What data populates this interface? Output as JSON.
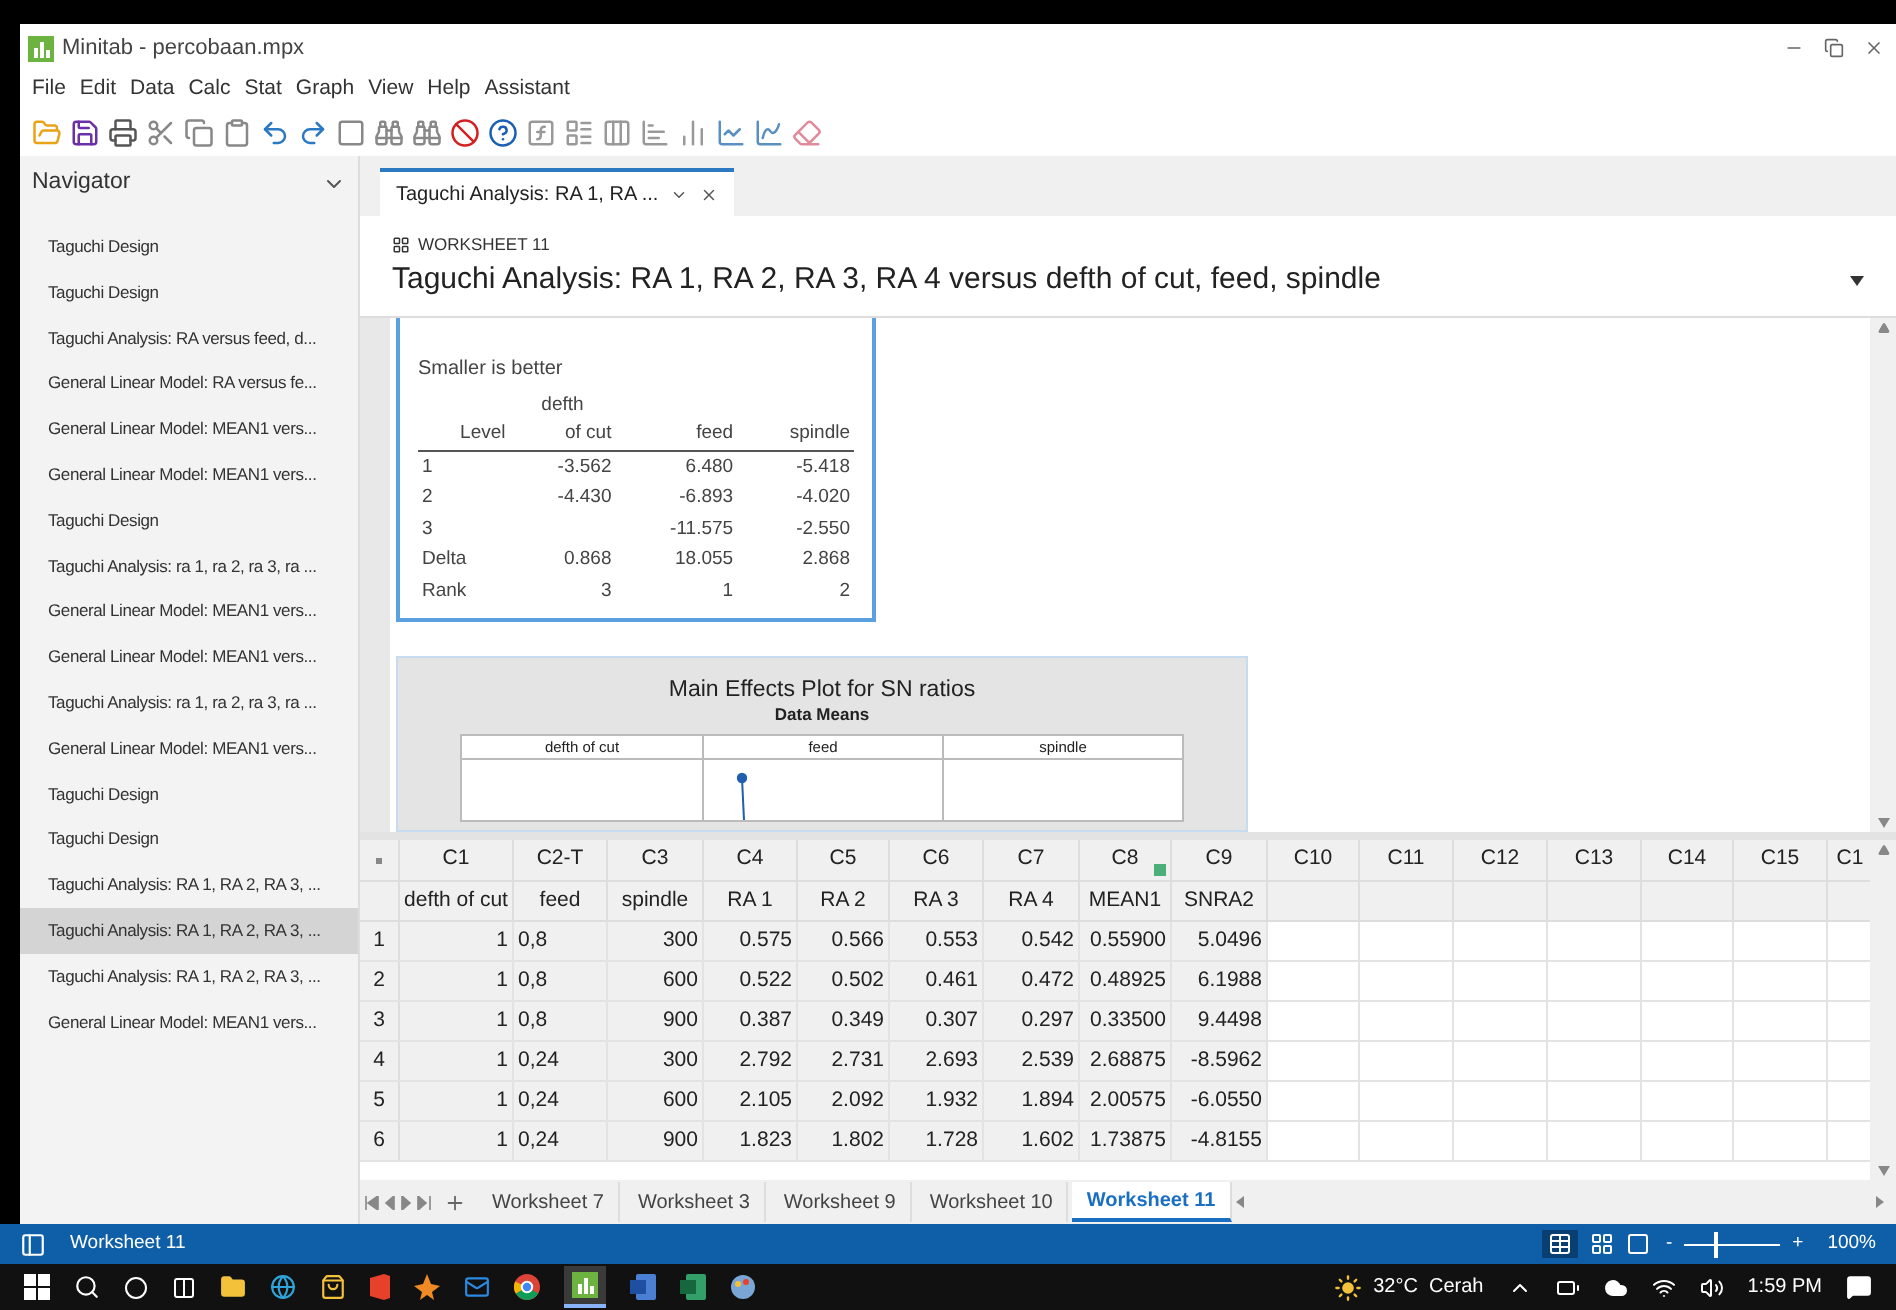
{
  "window": {
    "title": "Minitab - percobaan.mpx"
  },
  "menu": [
    "File",
    "Edit",
    "Data",
    "Calc",
    "Stat",
    "Graph",
    "View",
    "Help",
    "Assistant"
  ],
  "navigator": {
    "title": "Navigator",
    "items": [
      {
        "label": "Taguchi Design",
        "selected": false
      },
      {
        "label": "Taguchi Design",
        "selected": false
      },
      {
        "label": "Taguchi Analysis: RA versus feed, d...",
        "selected": false
      },
      {
        "label": "General Linear Model: RA versus fe...",
        "selected": false
      },
      {
        "label": "General Linear Model: MEAN1 vers...",
        "selected": false
      },
      {
        "label": "General Linear Model: MEAN1 vers...",
        "selected": false
      },
      {
        "label": "Taguchi Design",
        "selected": false
      },
      {
        "label": "Taguchi Analysis: ra 1, ra 2, ra 3, ra ...",
        "selected": false
      },
      {
        "label": "General Linear Model: MEAN1 vers...",
        "selected": false
      },
      {
        "label": "General Linear Model: MEAN1 vers...",
        "selected": false
      },
      {
        "label": "Taguchi Analysis: ra 1, ra 2, ra 3, ra ...",
        "selected": false
      },
      {
        "label": "General Linear Model: MEAN1 vers...",
        "selected": false
      },
      {
        "label": "Taguchi Design",
        "selected": false
      },
      {
        "label": "Taguchi Design",
        "selected": false
      },
      {
        "label": "Taguchi Analysis: RA 1, RA 2, RA 3, ...",
        "selected": false
      },
      {
        "label": "Taguchi Analysis: RA 1, RA 2, RA 3, ...",
        "selected": true
      },
      {
        "label": "Taguchi Analysis: RA 1, RA 2, RA 3, ...",
        "selected": false
      },
      {
        "label": "General Linear Model: MEAN1 vers...",
        "selected": false
      }
    ]
  },
  "output_tabs": [
    {
      "label": "Taguchi Analysis: RA 1, RA ...",
      "selected": true
    }
  ],
  "output": {
    "worksheet_label": "WORKSHEET 11",
    "title": "Taguchi Analysis: RA 1, RA 2, RA 3, RA 4 versus defth of cut, feed, spindle",
    "response_table": {
      "note": "Smaller is better",
      "columns": [
        {
          "label": "Level"
        },
        {
          "top": "defth",
          "label": "of cut"
        },
        {
          "label": "feed"
        },
        {
          "label": "spindle"
        }
      ],
      "rows": [
        [
          "1",
          "-3.562",
          "6.480",
          "-5.418"
        ],
        [
          "2",
          "-4.430",
          "-6.893",
          "-4.020"
        ],
        [
          "3",
          "",
          "-11.575",
          "-2.550"
        ],
        [
          "Delta",
          "0.868",
          "18.055",
          "2.868"
        ],
        [
          "Rank",
          "3",
          "1",
          "2"
        ]
      ]
    },
    "plot": {
      "title": "Main Effects Plot for SN ratios",
      "subtitle": "Data Means",
      "panels": [
        "defth of cut",
        "feed",
        "spindle"
      ]
    }
  },
  "worksheet": {
    "columns": [
      {
        "id": "C1",
        "name": "defth of cut"
      },
      {
        "id": "C2-T",
        "name": "feed"
      },
      {
        "id": "C3",
        "name": "spindle"
      },
      {
        "id": "C4",
        "name": "RA 1"
      },
      {
        "id": "C5",
        "name": "RA 2"
      },
      {
        "id": "C6",
        "name": "RA 3"
      },
      {
        "id": "C7",
        "name": "RA 4"
      },
      {
        "id": "C8",
        "name": "MEAN1",
        "formula": true
      },
      {
        "id": "C9",
        "name": "SNRA2"
      },
      {
        "id": "C10"
      },
      {
        "id": "C11"
      },
      {
        "id": "C12"
      },
      {
        "id": "C13"
      },
      {
        "id": "C14"
      },
      {
        "id": "C15"
      },
      {
        "id": "C1"
      }
    ],
    "rows": [
      {
        "num": "1",
        "cells": [
          "1",
          "0,8",
          "300",
          "0.575",
          "0.566",
          "0.553",
          "0.542",
          "0.55900",
          "5.0496"
        ]
      },
      {
        "num": "2",
        "cells": [
          "1",
          "0,8",
          "600",
          "0.522",
          "0.502",
          "0.461",
          "0.472",
          "0.48925",
          "6.1988"
        ]
      },
      {
        "num": "3",
        "cells": [
          "1",
          "0,8",
          "900",
          "0.387",
          "0.349",
          "0.307",
          "0.297",
          "0.33500",
          "9.4498"
        ]
      },
      {
        "num": "4",
        "cells": [
          "1",
          "0,24",
          "300",
          "2.792",
          "2.731",
          "2.693",
          "2.539",
          "2.68875",
          "-8.5962"
        ]
      },
      {
        "num": "5",
        "cells": [
          "1",
          "0,24",
          "600",
          "2.105",
          "2.092",
          "1.932",
          "1.894",
          "2.00575",
          "-6.0550"
        ]
      },
      {
        "num": "6",
        "cells": [
          "1",
          "0,24",
          "900",
          "1.823",
          "1.802",
          "1.728",
          "1.602",
          "1.73875",
          "-4.8155"
        ]
      }
    ],
    "sheet_tabs": [
      {
        "label": "Worksheet 7",
        "selected": false
      },
      {
        "label": "Worksheet 3",
        "selected": false
      },
      {
        "label": "Worksheet 9",
        "selected": false
      },
      {
        "label": "Worksheet 10",
        "selected": false
      },
      {
        "label": "Worksheet 11",
        "selected": true
      }
    ]
  },
  "status_bar": {
    "sheet": "Worksheet 11",
    "zoom_minus": "-",
    "zoom_plus": "+",
    "zoom": {
      "level": 0.3
    },
    "zoom_reading": "100%"
  },
  "taskbar": {
    "weather": "32°C  Cerah",
    "time": "1:59 PM"
  }
}
